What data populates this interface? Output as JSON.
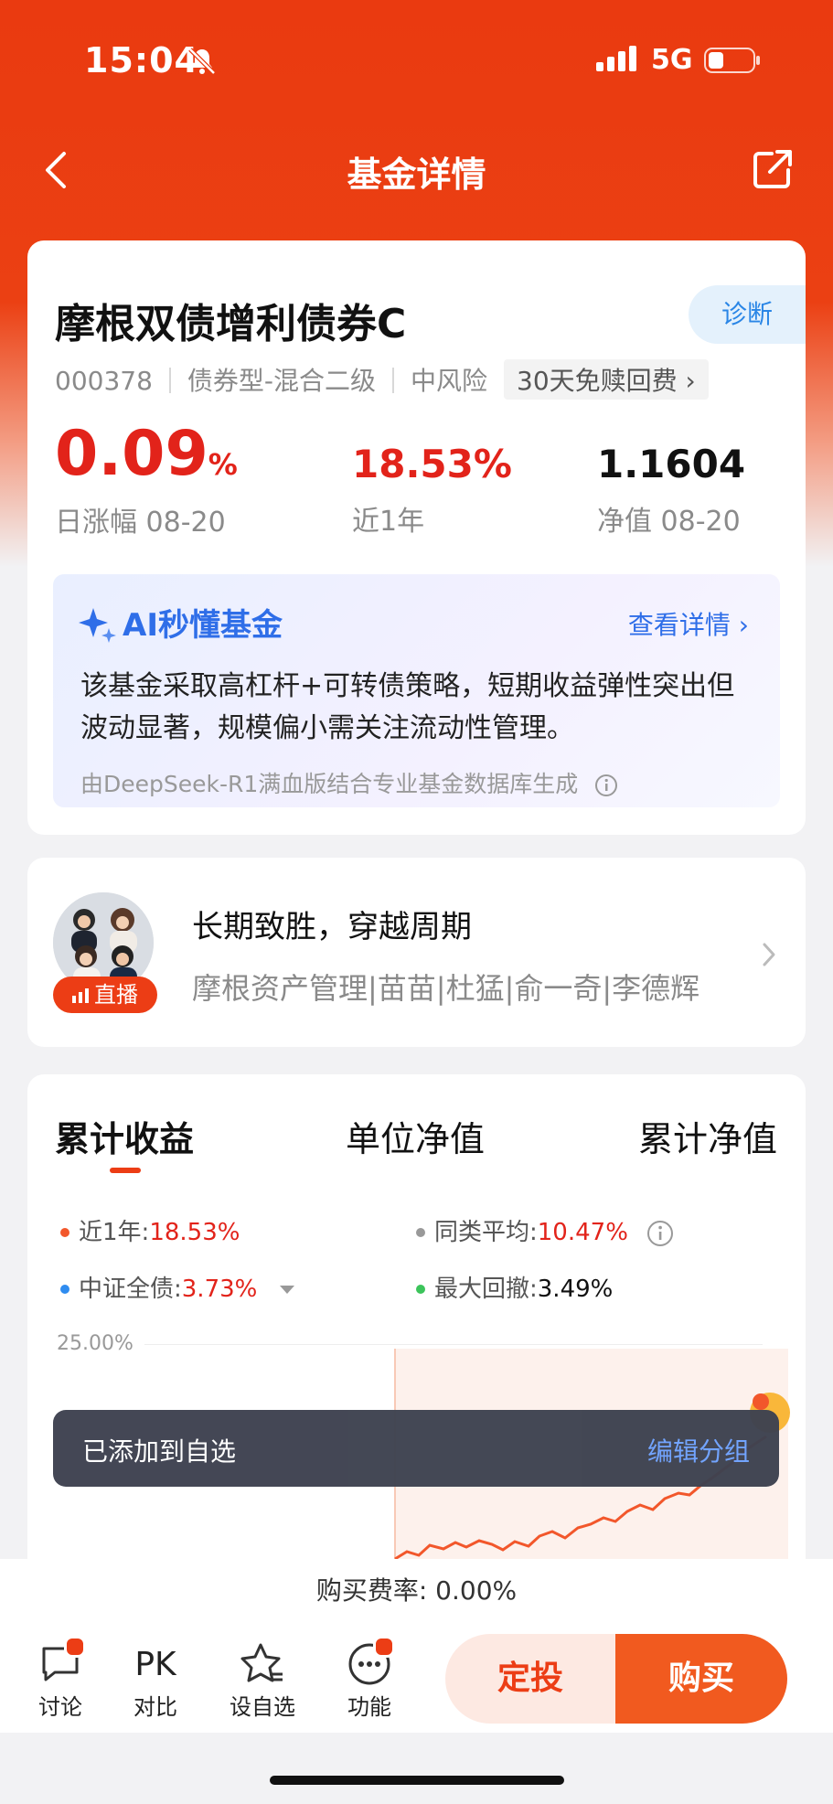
{
  "status": {
    "time": "15:04",
    "network": "5G"
  },
  "nav": {
    "title": "基金详情"
  },
  "fund": {
    "name": "摩根双债增利债券C",
    "diagnose": "诊断",
    "code": "000378",
    "type": "债券型-混合二级",
    "risk": "中风险",
    "fee_tag": "30天免赎回费 ›",
    "daily_change": "0.09",
    "daily_unit": "%",
    "daily_label": "日涨幅 08-20",
    "year_return": "18.53%",
    "year_label": "近1年",
    "nav_value": "1.1604",
    "nav_label": "净值 08-20"
  },
  "ai": {
    "title": "AI秒懂基金",
    "more": "查看详情 ›",
    "body": "该基金采取高杠杆+可转债策略，短期收益弹性突出但波动显著，规模偏小需关注流动性管理。",
    "source": "由DeepSeek-R1满血版结合专业基金数据库生成"
  },
  "manager": {
    "live_label": "直播",
    "title": "长期致胜，穿越周期",
    "subtitle": "摩根资产管理|苗苗|杜猛|俞一奇|李德辉"
  },
  "chart_section": {
    "tabs": [
      "累计收益",
      "单位净值",
      "累计净值"
    ],
    "legend": {
      "l1_label": "近1年:",
      "l1_value": "18.53%",
      "l2_label": "同类平均:",
      "l2_value": "10.47%",
      "l3_label": "中证全债:",
      "l3_value": "3.73%",
      "l4_label": "最大回撤:",
      "l4_value": "3.49%"
    },
    "y_top_label": "25.00%",
    "colors": {
      "fund": "#f2572b",
      "peer": "#999999",
      "index": "#2f8cf0",
      "drawdown": "#3cc45b"
    }
  },
  "toast": {
    "text": "已添加到自选",
    "action": "编辑分组"
  },
  "fee": {
    "text": "购买费率: 0.00%"
  },
  "bottom": {
    "discuss": "讨论",
    "pk_icon": "PK",
    "compare": "对比",
    "watch": "设自选",
    "more": "功能",
    "auto_invest": "定投",
    "buy": "购买"
  }
}
